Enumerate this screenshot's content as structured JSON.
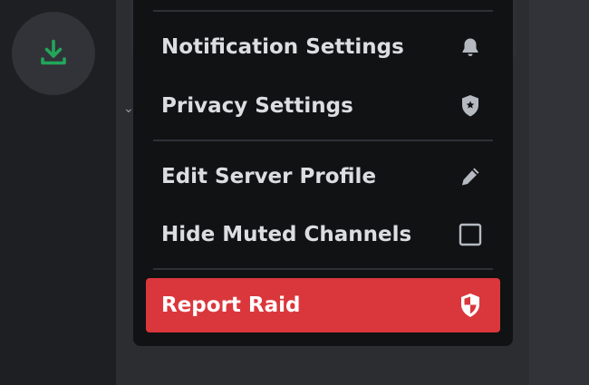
{
  "colors": {
    "rail": "#1e1f22",
    "menu_bg": "#111214",
    "text": "#dbdee1",
    "danger": "#da373c",
    "download_green": "#23a55a"
  },
  "server_rail": {
    "download_icon": "download-icon"
  },
  "menu": {
    "items": [
      {
        "label": "Notification Settings",
        "icon": "bell-icon"
      },
      {
        "label": "Privacy Settings",
        "icon": "shield-star-icon"
      },
      {
        "label": "Edit Server Profile",
        "icon": "pencil-icon"
      },
      {
        "label": "Hide Muted Channels",
        "icon": "checkbox-icon",
        "checked": false
      },
      {
        "label": "Report Raid",
        "icon": "shield-raid-icon",
        "danger": true
      }
    ]
  }
}
